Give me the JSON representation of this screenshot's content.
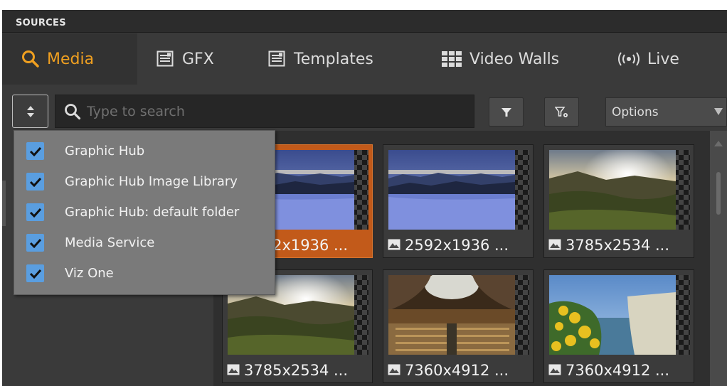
{
  "header": {
    "title": "SOURCES"
  },
  "tabs": [
    {
      "label": "Media",
      "icon": "search-icon",
      "active": true
    },
    {
      "label": "GFX",
      "icon": "gfx-icon",
      "active": false
    },
    {
      "label": "Templates",
      "icon": "templates-icon",
      "active": false
    },
    {
      "label": "Video Walls",
      "icon": "video-wall-icon",
      "active": false
    },
    {
      "label": "Live",
      "icon": "broadcast-icon",
      "active": false
    }
  ],
  "toolbar": {
    "search_placeholder": "Type to search",
    "search_value": "",
    "options_label": "Options"
  },
  "source_filter": {
    "items": [
      {
        "label": "Graphic Hub",
        "checked": true
      },
      {
        "label": "Graphic Hub Image Library",
        "checked": true
      },
      {
        "label": "Graphic Hub: default folder",
        "checked": true
      },
      {
        "label": "Media Service",
        "checked": true
      },
      {
        "label": "Viz One",
        "checked": true
      }
    ]
  },
  "media": {
    "items": [
      {
        "label": "2592x1936 ...",
        "scene": "snow-lake",
        "selected": true
      },
      {
        "label": "2592x1936 ...",
        "scene": "snow-lake",
        "selected": false
      },
      {
        "label": "3785x2534 ...",
        "scene": "sunset-hills",
        "selected": false
      },
      {
        "label": "3785x2534 ...",
        "scene": "sunset-hills",
        "selected": false
      },
      {
        "label": "7360x4912 ...",
        "scene": "library-hall",
        "selected": false
      },
      {
        "label": "7360x4912 ...",
        "scene": "cliff-flowers",
        "selected": false
      }
    ]
  },
  "colors": {
    "accent": "#f0a020",
    "selection": "#c25a1a",
    "checkbox": "#5a9ee0"
  }
}
